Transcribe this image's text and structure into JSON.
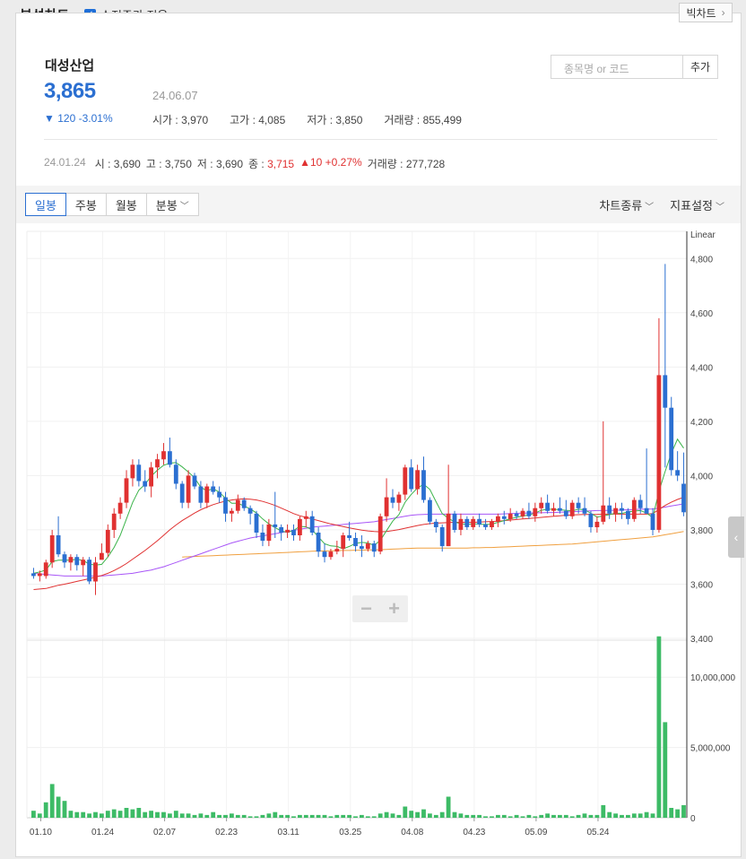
{
  "header": {
    "title": "분석차트",
    "adjusted_label": "수정주가 적용",
    "adjusted_checked": true,
    "big_chart_label": "빅차트"
  },
  "stock": {
    "name": "대성산업",
    "price": "3,865",
    "date": "24.06.07",
    "change": "120 -3.01%",
    "open_label": "시가",
    "open": "3,970",
    "high_label": "고가",
    "high": "4,085",
    "low_label": "저가",
    "low": "3,850",
    "vol_label": "거래량",
    "volume": "855,499"
  },
  "search": {
    "placeholder": "종목명 or 코드",
    "add_label": "추가"
  },
  "hover": {
    "date": "24.01.24",
    "o_label": "시",
    "o": "3,690",
    "h_label": "고",
    "h": "3,750",
    "l_label": "저",
    "l": "3,690",
    "c_label": "종",
    "c": "3,715",
    "change": "10 +0.27%",
    "vol_label": "거래량",
    "volume": "277,728"
  },
  "toolbar": {
    "tabs": [
      "일봉",
      "주봉",
      "월봉",
      "분봉"
    ],
    "active_tab": "일봉",
    "chart_type_label": "차트종류",
    "indicator_label": "지표설정"
  },
  "colors": {
    "up": "#e03131",
    "down": "#2b6fd1",
    "ma5": "#3cb44b",
    "ma20": "#e03131",
    "ma60": "#a855f7",
    "ma120": "#f0a040",
    "volume": "#3dbb66"
  },
  "chart_data": {
    "type": "candlestick",
    "scale_label": "Linear",
    "price_axis": {
      "ticks": [
        "4,800",
        "4,600",
        "4,400",
        "4,200",
        "4,000",
        "3,800",
        "3,600",
        "3,400"
      ],
      "range": [
        3400,
        4900
      ]
    },
    "volume_axis": {
      "ticks": [
        "10,000,000",
        "5,000,000",
        "0"
      ],
      "range": [
        0,
        12500000
      ]
    },
    "x_ticks": [
      "01.10",
      "01.24",
      "02.07",
      "02.23",
      "03.11",
      "03.25",
      "04.08",
      "04.23",
      "05.09",
      "05.24"
    ],
    "candles": [
      [
        3640,
        3660,
        3620,
        3630
      ],
      [
        3630,
        3650,
        3610,
        3640
      ],
      [
        3630,
        3690,
        3620,
        3680
      ],
      [
        3680,
        3800,
        3660,
        3780
      ],
      [
        3780,
        3850,
        3700,
        3710
      ],
      [
        3710,
        3720,
        3660,
        3680
      ],
      [
        3680,
        3710,
        3650,
        3700
      ],
      [
        3700,
        3710,
        3650,
        3670
      ],
      [
        3670,
        3700,
        3630,
        3690
      ],
      [
        3690,
        3700,
        3600,
        3610
      ],
      [
        3610,
        3700,
        3560,
        3680
      ],
      [
        3690,
        3750,
        3690,
        3715
      ],
      [
        3715,
        3820,
        3700,
        3800
      ],
      [
        3800,
        3880,
        3770,
        3860
      ],
      [
        3860,
        3920,
        3840,
        3900
      ],
      [
        3900,
        4020,
        3880,
        3990
      ],
      [
        3990,
        4060,
        3960,
        4040
      ],
      [
        4040,
        4060,
        3960,
        3980
      ],
      [
        3980,
        4020,
        3940,
        3960
      ],
      [
        3960,
        4050,
        3920,
        4030
      ],
      [
        4030,
        4080,
        3990,
        4060
      ],
      [
        4060,
        4120,
        4040,
        4090
      ],
      [
        4090,
        4140,
        4030,
        4040
      ],
      [
        4040,
        4060,
        3950,
        3970
      ],
      [
        3970,
        3980,
        3880,
        3900
      ],
      [
        3900,
        4020,
        3880,
        4000
      ],
      [
        4000,
        4010,
        3950,
        3960
      ],
      [
        3960,
        3980,
        3880,
        3900
      ],
      [
        3900,
        3970,
        3880,
        3960
      ],
      [
        3960,
        3980,
        3930,
        3940
      ],
      [
        3940,
        3960,
        3900,
        3920
      ],
      [
        3920,
        3940,
        3830,
        3860
      ],
      [
        3860,
        3880,
        3830,
        3870
      ],
      [
        3870,
        3930,
        3860,
        3910
      ],
      [
        3910,
        3920,
        3870,
        3880
      ],
      [
        3880,
        3890,
        3820,
        3860
      ],
      [
        3860,
        3870,
        3770,
        3790
      ],
      [
        3790,
        3820,
        3740,
        3760
      ],
      [
        3760,
        3840,
        3740,
        3820
      ],
      [
        3820,
        3940,
        3770,
        3810
      ],
      [
        3810,
        3820,
        3760,
        3790
      ],
      [
        3790,
        3820,
        3770,
        3800
      ],
      [
        3800,
        3820,
        3760,
        3780
      ],
      [
        3780,
        3850,
        3760,
        3840
      ],
      [
        3840,
        3870,
        3810,
        3850
      ],
      [
        3850,
        3870,
        3780,
        3790
      ],
      [
        3790,
        3810,
        3700,
        3720
      ],
      [
        3720,
        3750,
        3680,
        3700
      ],
      [
        3700,
        3730,
        3690,
        3720
      ],
      [
        3720,
        3760,
        3710,
        3730
      ],
      [
        3730,
        3790,
        3700,
        3780
      ],
      [
        3780,
        3830,
        3760,
        3770
      ],
      [
        3770,
        3790,
        3720,
        3740
      ],
      [
        3740,
        3780,
        3700,
        3730
      ],
      [
        3730,
        3760,
        3720,
        3750
      ],
      [
        3750,
        3760,
        3700,
        3720
      ],
      [
        3720,
        3860,
        3710,
        3850
      ],
      [
        3850,
        3990,
        3830,
        3920
      ],
      [
        3920,
        3950,
        3880,
        3900
      ],
      [
        3900,
        3940,
        3870,
        3930
      ],
      [
        3930,
        4040,
        3910,
        4030
      ],
      [
        4030,
        4060,
        3940,
        3950
      ],
      [
        3950,
        4040,
        3930,
        4020
      ],
      [
        4020,
        4070,
        3900,
        3910
      ],
      [
        3910,
        3920,
        3820,
        3830
      ],
      [
        3830,
        3840,
        3790,
        3810
      ],
      [
        3810,
        3820,
        3720,
        3740
      ],
      [
        3740,
        4040,
        3740,
        3860
      ],
      [
        3860,
        3870,
        3790,
        3800
      ],
      [
        3800,
        3860,
        3780,
        3840
      ],
      [
        3840,
        3850,
        3800,
        3810
      ],
      [
        3810,
        3850,
        3800,
        3840
      ],
      [
        3840,
        3860,
        3810,
        3820
      ],
      [
        3820,
        3840,
        3800,
        3810
      ],
      [
        3810,
        3840,
        3800,
        3830
      ],
      [
        3830,
        3860,
        3810,
        3850
      ],
      [
        3850,
        3870,
        3820,
        3840
      ],
      [
        3840,
        3880,
        3830,
        3860
      ],
      [
        3860,
        3870,
        3840,
        3850
      ],
      [
        3850,
        3880,
        3840,
        3870
      ],
      [
        3870,
        3900,
        3840,
        3850
      ],
      [
        3850,
        3900,
        3830,
        3880
      ],
      [
        3880,
        3920,
        3860,
        3900
      ],
      [
        3900,
        3930,
        3860,
        3870
      ],
      [
        3870,
        3900,
        3850,
        3880
      ],
      [
        3880,
        3920,
        3860,
        3870
      ],
      [
        3870,
        3910,
        3840,
        3850
      ],
      [
        3850,
        3910,
        3840,
        3900
      ],
      [
        3900,
        3920,
        3860,
        3880
      ],
      [
        3880,
        3920,
        3850,
        3860
      ],
      [
        3860,
        3870,
        3790,
        3810
      ],
      [
        3810,
        3850,
        3790,
        3830
      ],
      [
        3830,
        4200,
        3820,
        3890
      ],
      [
        3890,
        3920,
        3840,
        3860
      ],
      [
        3860,
        3900,
        3830,
        3880
      ],
      [
        3880,
        3900,
        3840,
        3870
      ],
      [
        3870,
        3880,
        3820,
        3840
      ],
      [
        3840,
        3920,
        3830,
        3910
      ],
      [
        3910,
        3930,
        3860,
        3880
      ],
      [
        3880,
        4100,
        3860,
        3860
      ],
      [
        3860,
        3880,
        3780,
        3800
      ],
      [
        3800,
        4580,
        3790,
        4370
      ],
      [
        4370,
        4780,
        4030,
        4250
      ],
      [
        4250,
        4290,
        4000,
        4020
      ],
      [
        4020,
        4090,
        3980,
        4000
      ],
      [
        3970,
        4085,
        3850,
        3865
      ]
    ],
    "volumes": [
      0.5,
      0.3,
      1.1,
      2.4,
      1.5,
      1.2,
      0.5,
      0.4,
      0.4,
      0.3,
      0.4,
      0.3,
      0.5,
      0.6,
      0.5,
      0.7,
      0.6,
      0.7,
      0.4,
      0.5,
      0.4,
      0.4,
      0.3,
      0.5,
      0.3,
      0.3,
      0.2,
      0.3,
      0.2,
      0.4,
      0.2,
      0.2,
      0.3,
      0.2,
      0.2,
      0.1,
      0.1,
      0.2,
      0.3,
      0.4,
      0.2,
      0.2,
      0.1,
      0.2,
      0.2,
      0.2,
      0.2,
      0.2,
      0.1,
      0.2,
      0.2,
      0.2,
      0.1,
      0.2,
      0.1,
      0.1,
      0.3,
      0.4,
      0.3,
      0.2,
      0.8,
      0.5,
      0.4,
      0.6,
      0.3,
      0.2,
      0.4,
      1.5,
      0.4,
      0.3,
      0.2,
      0.2,
      0.2,
      0.1,
      0.1,
      0.2,
      0.2,
      0.1,
      0.2,
      0.1,
      0.2,
      0.1,
      0.2,
      0.3,
      0.2,
      0.2,
      0.2,
      0.1,
      0.2,
      0.3,
      0.2,
      0.2,
      0.9,
      0.4,
      0.3,
      0.2,
      0.2,
      0.3,
      0.3,
      0.4,
      0.3,
      12.9,
      6.8,
      0.7,
      0.6,
      0.9
    ],
    "ma5": [
      3640,
      3645,
      3652,
      3683,
      3688,
      3688,
      3688,
      3692,
      3687,
      3674,
      3670,
      3673,
      3700,
      3735,
      3780,
      3840,
      3901,
      3946,
      3968,
      3998,
      4020,
      4038,
      4046,
      4048,
      4032,
      4013,
      3992,
      3957,
      3944,
      3952,
      3939,
      3916,
      3898,
      3898,
      3888,
      3877,
      3862,
      3840,
      3822,
      3808,
      3796,
      3791,
      3798,
      3813,
      3811,
      3800,
      3774,
      3749,
      3741,
      3739,
      3730,
      3739,
      3750,
      3754,
      3752,
      3743,
      3761,
      3797,
      3832,
      3856,
      3902,
      3931,
      3954,
      3968,
      3949,
      3904,
      3860,
      3843,
      3829,
      3823,
      3820,
      3823,
      3821,
      3820,
      3821,
      3828,
      3834,
      3841,
      3846,
      3851,
      3855,
      3862,
      3872,
      3876,
      3876,
      3874,
      3872,
      3870,
      3876,
      3874,
      3861,
      3847,
      3852,
      3856,
      3862,
      3861,
      3866,
      3869,
      3871,
      3862,
      3845,
      3942,
      4015,
      4082,
      4134,
      4101
    ],
    "ma20": [
      3580,
      3582,
      3584,
      3590,
      3596,
      3600,
      3605,
      3610,
      3615,
      3620,
      3626,
      3632,
      3640,
      3650,
      3662,
      3676,
      3692,
      3708,
      3724,
      3742,
      3760,
      3780,
      3800,
      3818,
      3834,
      3848,
      3862,
      3874,
      3884,
      3893,
      3900,
      3906,
      3910,
      3913,
      3914,
      3913,
      3910,
      3905,
      3898,
      3890,
      3880,
      3870,
      3860,
      3852,
      3846,
      3840,
      3834,
      3828,
      3822,
      3817,
      3812,
      3807,
      3803,
      3799,
      3796,
      3794,
      3793,
      3794,
      3797,
      3801,
      3806,
      3811,
      3816,
      3820,
      3823,
      3825,
      3826,
      3827,
      3828,
      3828,
      3828,
      3828,
      3829,
      3830,
      3831,
      3832,
      3834,
      3836,
      3838,
      3840,
      3842,
      3844,
      3846,
      3848,
      3850,
      3852,
      3854,
      3855,
      3856,
      3857,
      3857,
      3857,
      3858,
      3858,
      3858,
      3858,
      3858,
      3858,
      3858,
      3858,
      3860,
      3875,
      3890,
      3902,
      3912,
      3920
    ],
    "ma60": [
      3640,
      3638,
      3636,
      3634,
      3632,
      3630,
      3630,
      3630,
      3630,
      3630,
      3630,
      3630,
      3632,
      3634,
      3636,
      3638,
      3640,
      3644,
      3648,
      3652,
      3658,
      3664,
      3672,
      3680,
      3688,
      3696,
      3704,
      3712,
      3720,
      3728,
      3736,
      3744,
      3752,
      3758,
      3764,
      3770,
      3774,
      3778,
      3782,
      3786,
      3790,
      3794,
      3798,
      3802,
      3806,
      3810,
      3812,
      3814,
      3816,
      3818,
      3820,
      3822,
      3824,
      3826,
      3828,
      3830,
      3834,
      3838,
      3842,
      3846,
      3850,
      3854,
      3856,
      3857,
      3858,
      3858,
      3858,
      3858,
      3858,
      3858,
      3858,
      3858,
      3858,
      3858,
      3858,
      3858,
      3859,
      3860,
      3861,
      3862,
      3862,
      3863,
      3863,
      3864,
      3864,
      3865,
      3866,
      3867,
      3868,
      3869,
      3870,
      3871,
      3871,
      3872,
      3872,
      3873,
      3874,
      3875,
      3876,
      3876,
      3877,
      3880,
      3884,
      3888,
      3892,
      3896
    ],
    "ma120": [
      null,
      null,
      null,
      null,
      null,
      null,
      null,
      null,
      null,
      null,
      null,
      null,
      null,
      null,
      null,
      null,
      null,
      null,
      null,
      null,
      null,
      null,
      null,
      null,
      3700,
      3701,
      3702,
      3703,
      3704,
      3705,
      3706,
      3707,
      3708,
      3709,
      3710,
      3711,
      3712,
      3713,
      3714,
      3715,
      3716,
      3717,
      3718,
      3719,
      3720,
      3721,
      3722,
      3722,
      3723,
      3723,
      3724,
      3724,
      3725,
      3725,
      3726,
      3726,
      3727,
      3728,
      3729,
      3730,
      3731,
      3732,
      3733,
      3733,
      3733,
      3733,
      3733,
      3733,
      3733,
      3733,
      3733,
      3734,
      3734,
      3735,
      3735,
      3736,
      3737,
      3738,
      3739,
      3740,
      3741,
      3742,
      3743,
      3744,
      3745,
      3746,
      3747,
      3748,
      3750,
      3752,
      3754,
      3756,
      3758,
      3760,
      3762,
      3764,
      3766,
      3768,
      3770,
      3772,
      3774,
      3778,
      3782,
      3786,
      3790,
      3794
    ]
  }
}
